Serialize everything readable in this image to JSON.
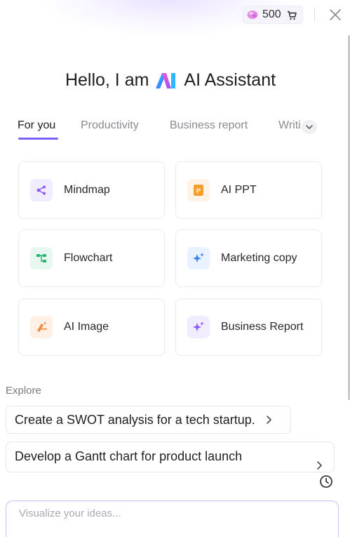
{
  "header": {
    "credits": "500"
  },
  "greeting": {
    "prefix": "Hello, I am",
    "name": "AI Assistant"
  },
  "tabs": [
    {
      "label": "For you"
    },
    {
      "label": "Productivity"
    },
    {
      "label": "Business report"
    },
    {
      "label": "Writi"
    }
  ],
  "tools": [
    {
      "label": "Mindmap",
      "icon": "mindmap-icon",
      "color": "#8b5cf6",
      "bg": "#f1ecfe"
    },
    {
      "label": "AI PPT",
      "icon": "ppt-icon",
      "color": "#f59e2b",
      "bg": "#fff3e6"
    },
    {
      "label": "Flowchart",
      "icon": "flowchart-icon",
      "color": "#22b573",
      "bg": "#e8f8f0"
    },
    {
      "label": "Marketing copy",
      "icon": "sparkle-icon",
      "color": "#3b82f6",
      "bg": "#eaf2ff"
    },
    {
      "label": "AI Image",
      "icon": "image-brush-icon",
      "color": "#f08a3a",
      "bg": "#fff0e6"
    },
    {
      "label": "Business Report",
      "icon": "sparkle-icon",
      "color": "#8b5cf6",
      "bg": "#f1ecfe"
    }
  ],
  "explore": {
    "label": "Explore",
    "suggestions": [
      "Create a SWOT analysis for a tech startup.",
      "Develop a Gantt chart for product launch"
    ]
  },
  "input": {
    "placeholder": "Visualize your ideas..."
  },
  "colors": {
    "accent": "#7b61ff"
  }
}
